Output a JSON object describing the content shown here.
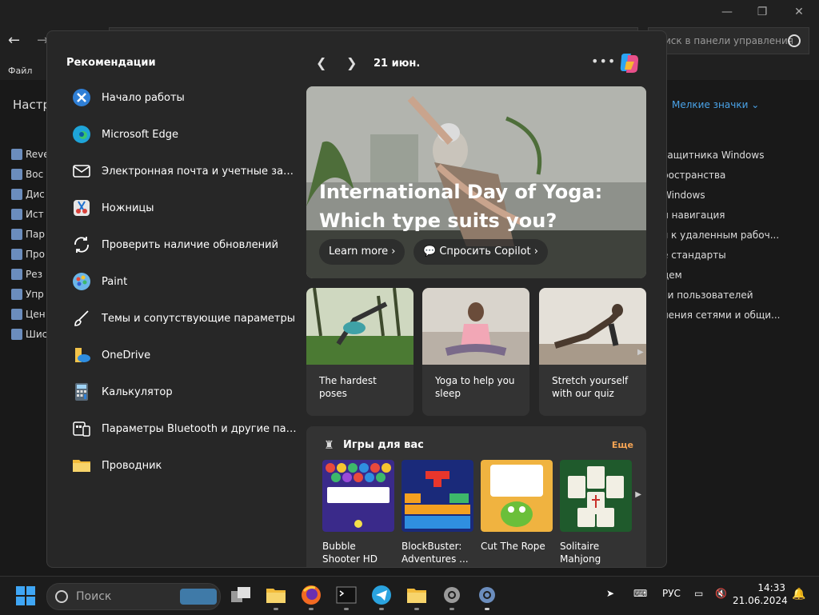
{
  "background_window": {
    "search_placeholder": "иск в панели управления",
    "menu_file": "Файл",
    "heading": "Настр",
    "view_by": "Мелкие значки",
    "left_items": [
      "Reve",
      "Вос",
      "Дис",
      "Ист",
      "Пар",
      "Про",
      "Рез",
      "Упр",
      "Цен",
      "Шис"
    ],
    "right_items": [
      "защитника Windows",
      "ространства",
      "Windows",
      "и навигация",
      "я к удаленным рабоч...",
      "е стандарты",
      "дем",
      "си пользователей",
      "ления сетями и общи..."
    ]
  },
  "widgets": {
    "recommendations_title": "Рекомендации",
    "date": "21 июн.",
    "recommendations": [
      {
        "label": "Начало работы",
        "icon": "get-started-icon"
      },
      {
        "label": "Microsoft Edge",
        "icon": "edge-icon"
      },
      {
        "label": "Электронная почта и учетные записи",
        "icon": "mail-icon"
      },
      {
        "label": "Ножницы",
        "icon": "snipping-tool-icon"
      },
      {
        "label": "Проверить наличие обновлений",
        "icon": "sync-icon"
      },
      {
        "label": "Paint",
        "icon": "paint-icon"
      },
      {
        "label": "Темы и сопутствующие параметры",
        "icon": "brush-icon"
      },
      {
        "label": "OneDrive",
        "icon": "onedrive-icon"
      },
      {
        "label": "Калькулятор",
        "icon": "calculator-icon"
      },
      {
        "label": "Параметры Bluetooth и другие пара...",
        "icon": "bluetooth-devices-icon"
      },
      {
        "label": "Проводник",
        "icon": "folder-icon"
      }
    ],
    "hero": {
      "title": "International Day of Yoga: Which type suits you?",
      "learn_more": "Learn more",
      "ask_copilot": "Спросить Copilot"
    },
    "cards": [
      {
        "title": "The hardest poses"
      },
      {
        "title": "Yoga to help you sleep"
      },
      {
        "title": "Stretch yourself with our quiz"
      }
    ],
    "games": {
      "title": "Игры для вас",
      "more": "Еще",
      "items": [
        {
          "title": "Bubble Shooter HD"
        },
        {
          "title": "BlockBuster: Adventures ..."
        },
        {
          "title": "Cut The Rope"
        },
        {
          "title": "Solitaire Mahjong Classic"
        }
      ]
    }
  },
  "taskbar": {
    "search_placeholder": "Поиск",
    "language": "РУС",
    "time": "14:33",
    "date": "21.06.2024"
  },
  "colors": {
    "accent_blue": "#3fa6f5",
    "link_orange": "#f5a454",
    "panel_bg": "#272727"
  }
}
